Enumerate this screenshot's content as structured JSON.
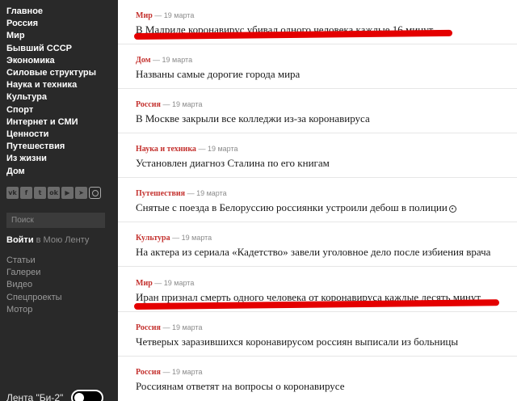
{
  "sidebar": {
    "nav": [
      "Главное",
      "Россия",
      "Мир",
      "Бывший СССР",
      "Экономика",
      "Силовые структуры",
      "Наука и техника",
      "Культура",
      "Спорт",
      "Интернет и СМИ",
      "Ценности",
      "Путешествия",
      "Из жизни",
      "Дом"
    ],
    "socials": [
      {
        "icon": "vk-icon",
        "glyph": "vk"
      },
      {
        "icon": "facebook-icon",
        "glyph": "f"
      },
      {
        "icon": "twitter-icon",
        "glyph": "t"
      },
      {
        "icon": "odnoklassniki-icon",
        "glyph": "ok"
      },
      {
        "icon": "youtube-icon",
        "glyph": "▶"
      },
      {
        "icon": "telegram-icon",
        "glyph": "➤"
      },
      {
        "icon": "instagram-icon",
        "glyph": ""
      }
    ],
    "search_placeholder": "Поиск",
    "login_label": "Войти",
    "login_suffix": " в Мою Ленту",
    "extra": [
      "Статьи",
      "Галереи",
      "Видео",
      "Спецпроекты",
      "Мотор"
    ],
    "toggle_label": "Лента \"Би-2\""
  },
  "feed": [
    {
      "rubric": "Мир",
      "date": "— 19 марта",
      "headline": "В Мадриде коронавирус убивал одного человека каждые 16 минут",
      "marker": false
    },
    {
      "rubric": "Дом",
      "date": "— 19 марта",
      "headline": "Названы самые дорогие города мира",
      "marker": false
    },
    {
      "rubric": "Россия",
      "date": "— 19 марта",
      "headline": "В Москве закрыли все колледжи из-за коронавируса",
      "marker": false
    },
    {
      "rubric": "Наука и техника",
      "date": "— 19 марта",
      "headline": "Установлен диагноз Сталина по его книгам",
      "marker": false
    },
    {
      "rubric": "Путешествия",
      "date": "— 19 марта",
      "headline": "Снятые с поезда в Белоруссию россиянки устроили дебош в полиции",
      "marker": true
    },
    {
      "rubric": "Культура",
      "date": "— 19 марта",
      "headline": "На актера из сериала «Кадетство» завели уголовное дело после избиения врача",
      "marker": false
    },
    {
      "rubric": "Мир",
      "date": "— 19 марта",
      "headline": "Иран признал смерть одного человека от коронавируса каждые десять минут",
      "marker": false
    },
    {
      "rubric": "Россия",
      "date": "— 19 марта",
      "headline": "Четверых заразившихся коронавирусом россиян выписали из больницы",
      "marker": false
    },
    {
      "rubric": "Россия",
      "date": "— 19 марта",
      "headline": "Россиянам ответят на вопросы о коронавирусе",
      "marker": false
    }
  ],
  "colors": {
    "sidebar_bg": "#292929",
    "rubric": "#c4322f",
    "highlight": "#e40000"
  }
}
